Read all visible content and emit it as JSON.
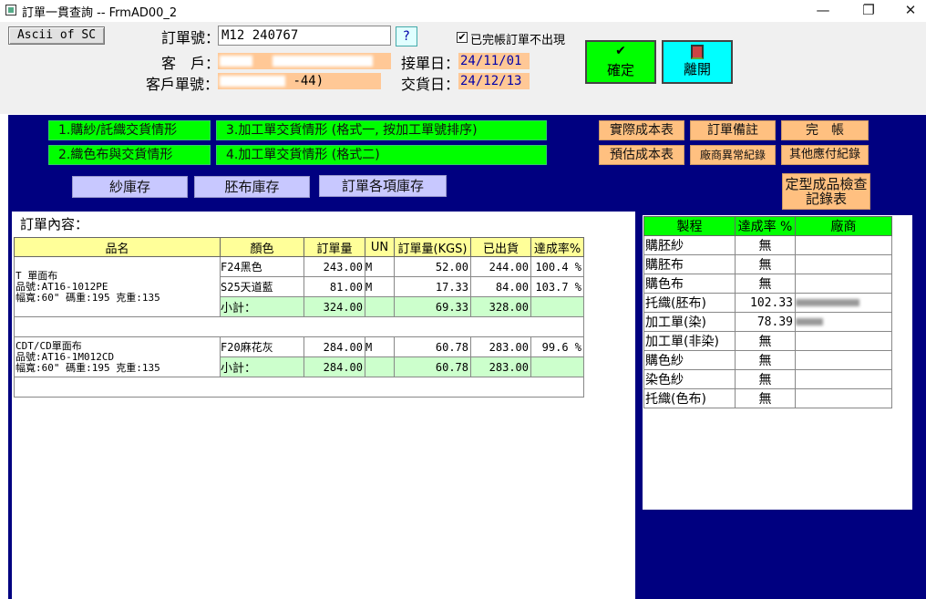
{
  "window": {
    "title": "訂單一貫查詢 -- FrmAD00_2",
    "minimize": "—",
    "restore": "❐",
    "close": "✕"
  },
  "top": {
    "ascii_button": "Ascii of SC",
    "order_no_label": "訂單號：",
    "order_no_value": "M12  240767",
    "help_button": "?",
    "checkbox_label": "已完帳訂單不出現",
    "checkbox_checked": true,
    "customer_label": "客　戶：",
    "customer_value": "",
    "customer_order_label": "客戶單號：",
    "customer_order_value": "-44)",
    "receive_date_label": "接單日：",
    "receive_date_value": "24/11/01",
    "delivery_date_label": "交貨日：",
    "delivery_date_value": "24/12/13",
    "confirm_button": "確定",
    "exit_button": "離開"
  },
  "panel": {
    "green_buttons": [
      "1.購紗/託織交貨情形",
      "2.織色布與交貨情形",
      "3.加工單交貨情形 (格式一, 按加工單號排序)",
      "4.加工單交貨情形 (格式二)"
    ],
    "orange_buttons": [
      "實際成本表",
      "訂單備註",
      "完　帳",
      "預估成本表",
      "廠商異常紀錄",
      "其他應付紀錄"
    ],
    "inspection_button": "定型成品檢查記錄表",
    "inventory_buttons": [
      "紗庫存",
      "胚布庫存",
      "訂單各項庫存"
    ]
  },
  "order": {
    "title": "訂單內容：",
    "columns": [
      "品名",
      "顏色",
      "訂單量",
      "UN",
      "訂單量(KGS)",
      "已出貨",
      "達成率%"
    ],
    "subtotal_label": "小計：",
    "groups": [
      {
        "product": [
          "T 單面布",
          "品號:AT16-1012PE",
          "幅寬:60\" 碼重:195 克重:135"
        ],
        "rows": [
          {
            "color": "F24黑色",
            "qty": "243.00",
            "un": "M",
            "kgs": "52.00",
            "shipped": "244.00",
            "rate": "100.4 %"
          },
          {
            "color": "S25天道藍",
            "qty": "81.00",
            "un": "M",
            "kgs": "17.33",
            "shipped": "84.00",
            "rate": "103.7 %"
          }
        ],
        "subtotal": {
          "qty": "324.00",
          "kgs": "69.33",
          "shipped": "328.00"
        }
      },
      {
        "product": [
          "CDT/CD單面布",
          "品號:AT16-1M012CD",
          "幅寬:60\" 碼重:195 克重:135"
        ],
        "rows": [
          {
            "color": "F20麻花灰",
            "qty": "284.00",
            "un": "M",
            "kgs": "60.78",
            "shipped": "283.00",
            "rate": "99.6 %"
          }
        ],
        "subtotal": {
          "qty": "284.00",
          "kgs": "60.78",
          "shipped": "283.00"
        }
      }
    ]
  },
  "process": {
    "columns": [
      "製程",
      "達成率 %",
      "廠商"
    ],
    "rows": [
      {
        "name": "購胚紗",
        "rate": "無",
        "vendor": ""
      },
      {
        "name": "購胚布",
        "rate": "無",
        "vendor": ""
      },
      {
        "name": "購色布",
        "rate": "無",
        "vendor": ""
      },
      {
        "name": "托織(胚布)",
        "rate": "102.33",
        "vendor": ""
      },
      {
        "name": "加工單(染)",
        "rate": "78.39",
        "vendor": ""
      },
      {
        "name": "加工單(非染)",
        "rate": "無",
        "vendor": ""
      },
      {
        "name": "購色紗",
        "rate": "無",
        "vendor": ""
      },
      {
        "name": "染色紗",
        "rate": "無",
        "vendor": ""
      },
      {
        "name": "托織(色布)",
        "rate": "無",
        "vendor": ""
      }
    ]
  }
}
